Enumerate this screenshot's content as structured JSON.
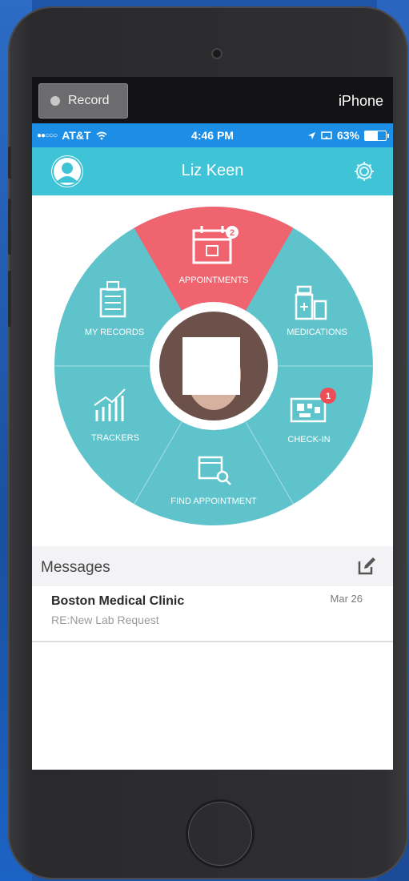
{
  "recorder": {
    "record_label": "Record",
    "device_label": "iPhone"
  },
  "status_bar": {
    "carrier": "AT&T",
    "time": "4:46 PM",
    "battery": "63%",
    "battery_level": 0.63
  },
  "app_bar": {
    "user_name": "Liz Keen"
  },
  "wheel": {
    "segments": [
      {
        "label": "APPOINTMENTS",
        "badge": "2",
        "highlighted": true
      },
      {
        "label": "MEDICATIONS"
      },
      {
        "label": "CHECK-IN",
        "badge": "1"
      },
      {
        "label": "FIND APPOINTMENT"
      },
      {
        "label": "TRACKERS"
      },
      {
        "label": "MY RECORDS"
      }
    ],
    "colors": {
      "base": "#5fc3cc",
      "highlight": "#f06470",
      "badge": "#ef4c55"
    }
  },
  "messages": {
    "title": "Messages",
    "items": [
      {
        "sender": "Boston Medical Clinic",
        "date": "Mar 26",
        "preview": "RE:New Lab Request"
      }
    ]
  }
}
